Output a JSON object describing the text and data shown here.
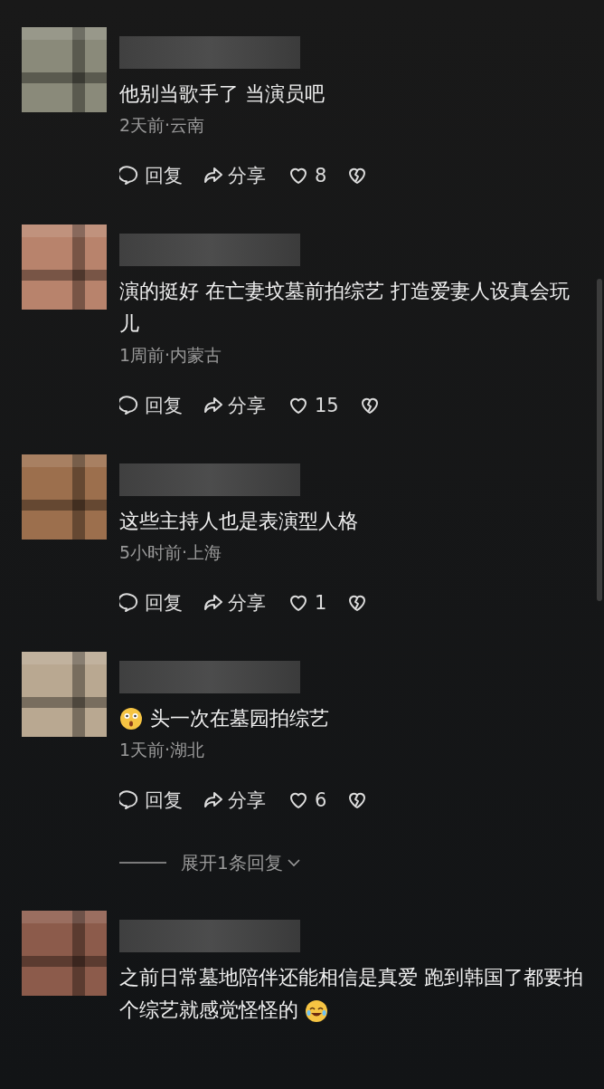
{
  "comments": [
    {
      "text": "他别当歌手了  当演员吧",
      "meta": "2天前·云南",
      "actions": {
        "reply": "回复",
        "share": "分享",
        "likes": "8"
      }
    },
    {
      "text": "演的挺好 在亡妻坟墓前拍综艺 打造爱妻人设真会玩儿",
      "meta": "1周前·内蒙古",
      "actions": {
        "reply": "回复",
        "share": "分享",
        "likes": "15"
      }
    },
    {
      "text": "这些主持人也是表演型人格",
      "meta": "5小时前·上海",
      "actions": {
        "reply": "回复",
        "share": "分享",
        "likes": "1"
      }
    },
    {
      "lead_emoji": true,
      "text": "头一次在墓园拍综艺",
      "meta": "1天前·湖北",
      "actions": {
        "reply": "回复",
        "share": "分享",
        "likes": "6"
      },
      "expand": "展开1条回复"
    },
    {
      "text": "之前日常墓地陪伴还能相信是真爱 跑到韩国了都要拍个综艺就感觉怪怪的",
      "trail_emoji": true
    }
  ]
}
